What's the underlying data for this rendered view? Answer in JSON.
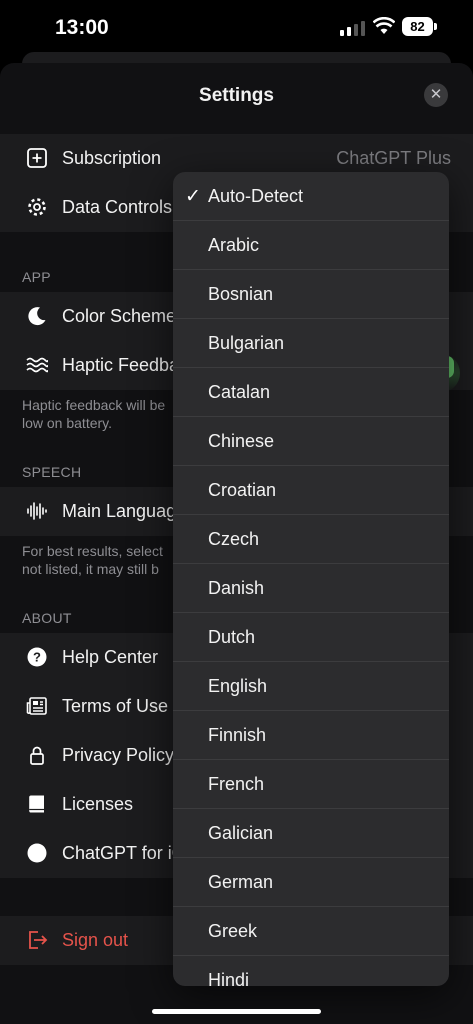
{
  "status": {
    "time": "13:00",
    "battery": "82"
  },
  "sheet": {
    "title": "Settings",
    "close_icon": "close-icon"
  },
  "account": {
    "subscription_label": "Subscription",
    "subscription_value": "ChatGPT Plus",
    "data_controls_label": "Data Controls"
  },
  "app": {
    "header": "APP",
    "color_scheme_label": "Color Scheme",
    "haptic_label": "Haptic Feedback",
    "haptic_enabled": true,
    "haptic_note": "Haptic feedback will be\nlow on battery."
  },
  "speech": {
    "header": "SPEECH",
    "main_language_label": "Main Language",
    "note": "For best results, select\nnot listed, it may still b"
  },
  "about": {
    "header": "ABOUT",
    "items": [
      "Help Center",
      "Terms of Use",
      "Privacy Policy",
      "Licenses",
      "ChatGPT for iOS"
    ]
  },
  "signout_label": "Sign out",
  "language_dropdown": {
    "selected": "Auto-Detect",
    "options": [
      "Auto-Detect",
      "Arabic",
      "Bosnian",
      "Bulgarian",
      "Catalan",
      "Chinese",
      "Croatian",
      "Czech",
      "Danish",
      "Dutch",
      "English",
      "Finnish",
      "French",
      "Galician",
      "German",
      "Greek",
      "Hindi"
    ]
  },
  "colors": {
    "background": "#111113",
    "row": "#1c1c1e",
    "menu": "#2c2c2e",
    "danger": "#e5534b",
    "toggle_on": "#63c26a"
  }
}
